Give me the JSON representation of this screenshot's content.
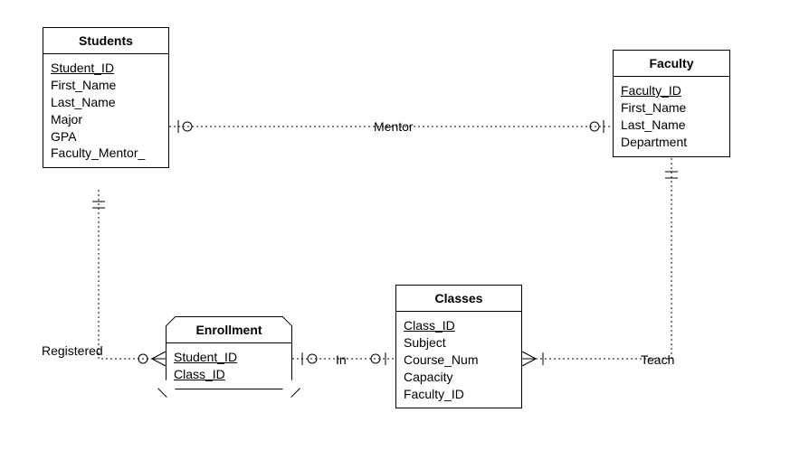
{
  "entities": {
    "students": {
      "title": "Students",
      "attrs": [
        "Student_ID",
        "First_Name",
        "Last_Name",
        "Major",
        "GPA",
        "Faculty_Mentor_"
      ],
      "pk_indices": [
        0
      ]
    },
    "faculty": {
      "title": "Faculty",
      "attrs": [
        "Faculty_ID",
        "First_Name",
        "Last_Name",
        "Department"
      ],
      "pk_indices": [
        0
      ]
    },
    "enrollment": {
      "title": "Enrollment",
      "attrs": [
        "Student_ID",
        "Class_ID"
      ],
      "pk_indices": [
        0,
        1
      ]
    },
    "classes": {
      "title": "Classes",
      "attrs": [
        "Class_ID",
        "Subject",
        "Course_Num",
        "Capacity",
        "Faculty_ID"
      ],
      "pk_indices": [
        0
      ]
    }
  },
  "relationships": {
    "mentor": "Mentor",
    "registered": "Registered",
    "in": "In",
    "teach": "Teach"
  },
  "chart_data": {
    "type": "er-diagram",
    "entities": [
      {
        "name": "Students",
        "primary_key": [
          "Student_ID"
        ],
        "attributes": [
          "Student_ID",
          "First_Name",
          "Last_Name",
          "Major",
          "GPA",
          "Faculty_Mentor_"
        ]
      },
      {
        "name": "Faculty",
        "primary_key": [
          "Faculty_ID"
        ],
        "attributes": [
          "Faculty_ID",
          "First_Name",
          "Last_Name",
          "Department"
        ]
      },
      {
        "name": "Enrollment",
        "associative": true,
        "primary_key": [
          "Student_ID",
          "Class_ID"
        ],
        "attributes": [
          "Student_ID",
          "Class_ID"
        ]
      },
      {
        "name": "Classes",
        "primary_key": [
          "Class_ID"
        ],
        "attributes": [
          "Class_ID",
          "Subject",
          "Course_Num",
          "Capacity",
          "Faculty_ID"
        ]
      }
    ],
    "relationships": [
      {
        "name": "Mentor",
        "between": [
          "Students",
          "Faculty"
        ],
        "cardinality": {
          "Students": "zero-or-one",
          "Faculty": "zero-or-one"
        }
      },
      {
        "name": "Registered",
        "between": [
          "Students",
          "Enrollment"
        ],
        "cardinality": {
          "Students": "one-and-only-one",
          "Enrollment": "zero-or-many"
        }
      },
      {
        "name": "In",
        "between": [
          "Enrollment",
          "Classes"
        ],
        "cardinality": {
          "Enrollment": "zero-or-one",
          "Classes": "zero-or-one"
        }
      },
      {
        "name": "Teach",
        "between": [
          "Classes",
          "Faculty"
        ],
        "cardinality": {
          "Classes": "one-or-many",
          "Faculty": "one-and-only-one"
        }
      }
    ]
  }
}
